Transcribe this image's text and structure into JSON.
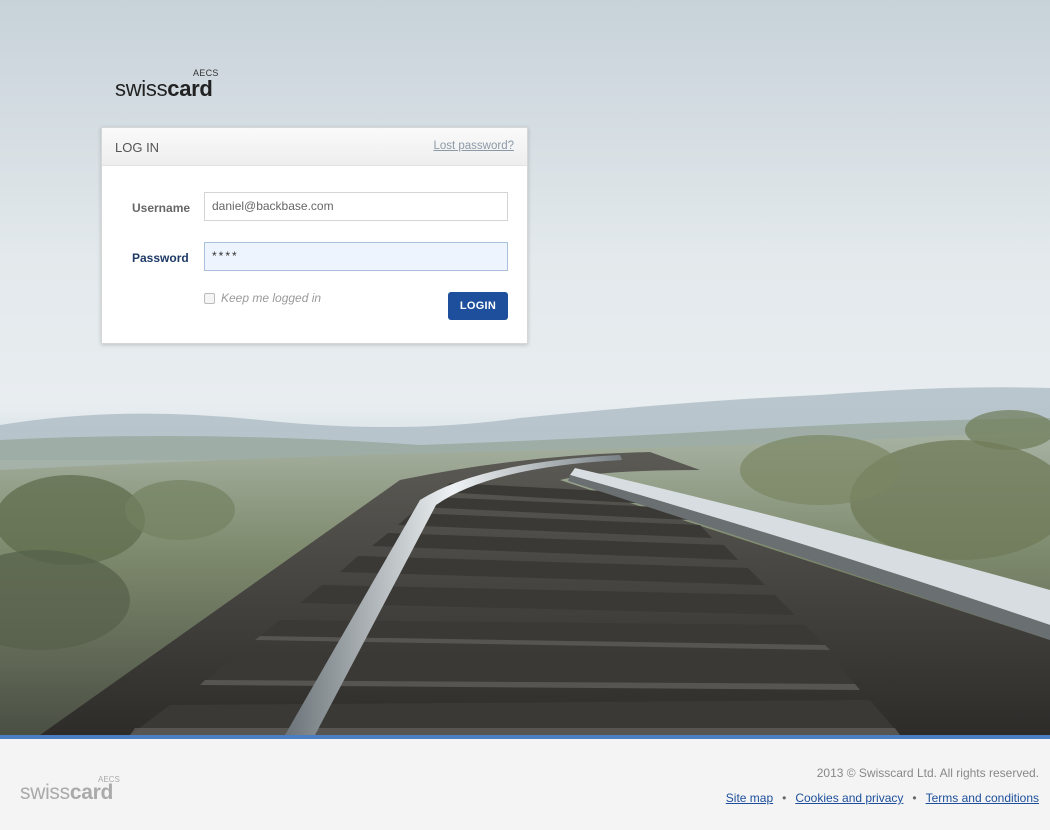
{
  "brand": {
    "prefix": "swiss",
    "suffix": "card",
    "tag": "AECS"
  },
  "login": {
    "title": "LOG IN",
    "lost_password": "Lost password?",
    "username_label": "Username",
    "username_value": "daniel@backbase.com",
    "password_label": "Password",
    "password_value": "****",
    "remember_label": "Keep me logged in",
    "remember_checked": false,
    "submit_label": "LOGIN"
  },
  "footer": {
    "copyright": "2013 © Swisscard Ltd. All rights reserved.",
    "links": [
      "Site map",
      "Cookies and privacy",
      "Terms and conditions"
    ],
    "separator": "•"
  },
  "colors": {
    "accent": "#1d4f9c",
    "footer_border": "#4b7fc4",
    "password_focus_bg": "#eef4fd"
  },
  "icons": {
    "checkbox": "checkbox-icon"
  }
}
